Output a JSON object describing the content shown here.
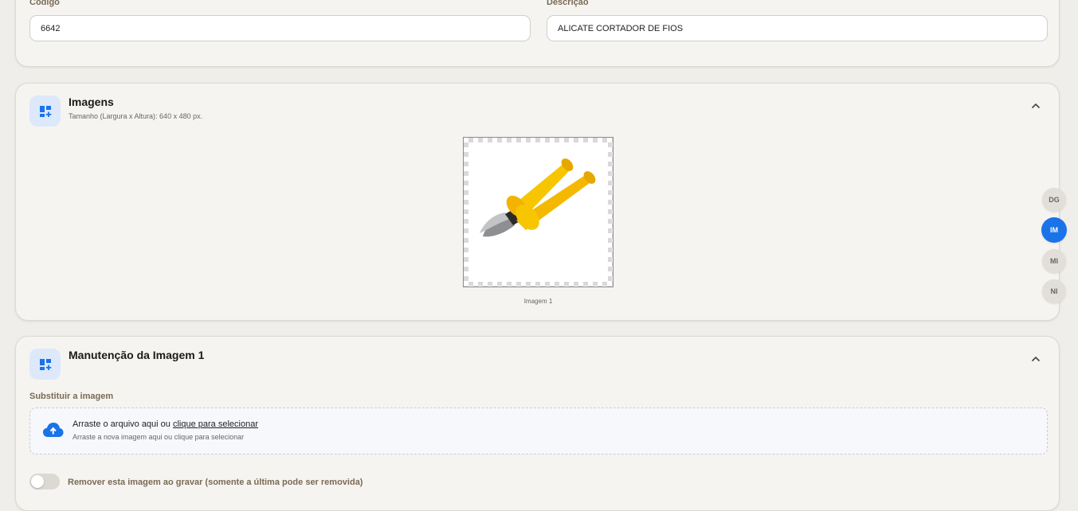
{
  "general": {
    "codigo_label": "Código",
    "codigo_value": "6642",
    "descricao_label": "Descrição",
    "descricao_value": "ALICATE CORTADOR DE FIOS"
  },
  "images_section": {
    "title": "Imagens",
    "subtitle": "Tamanho (Largura x Altura): 640 x 480 px.",
    "icon": "dashboard-add-icon",
    "collapse_icon": "chevron-up-icon",
    "items": [
      {
        "caption": "Imagem 1",
        "image": "yellow-wire-cutter-pliers"
      }
    ]
  },
  "maintenance_section": {
    "title": "Manutenção da Imagem 1",
    "icon": "dashboard-add-icon",
    "collapse_icon": "chevron-up-icon",
    "replace_label": "Substituir a imagem",
    "drop_text": "Arraste o arquivo aqui ou",
    "drop_link": "clique para selecionar",
    "drop_sub": "Arraste a nova imagem aqui ou clique para selecionar",
    "drop_icon": "cloud-upload-icon",
    "remove_label": "Remover esta imagem ao gravar (somente a última pode ser removida)",
    "remove_checked": false
  },
  "side_nav": {
    "items": [
      {
        "label": "DG",
        "active": false
      },
      {
        "label": "IM",
        "active": true
      },
      {
        "label": "MI",
        "active": false
      },
      {
        "label": "NI",
        "active": false
      }
    ]
  },
  "colors": {
    "accent": "#1a73e8",
    "label_brown": "#7a6a55",
    "background": "#f0eeea"
  }
}
